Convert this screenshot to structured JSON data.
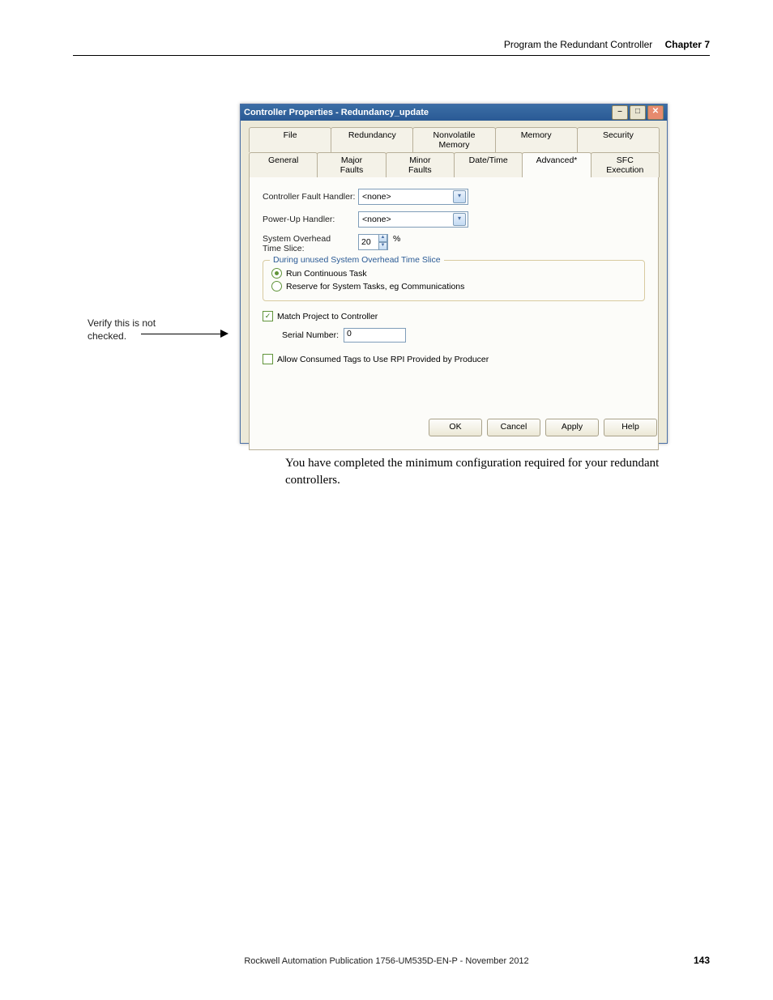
{
  "header": {
    "title": "Program the Redundant Controller",
    "chapter": "Chapter 7"
  },
  "callout": {
    "line1": "Verify this is not",
    "line2": "checked."
  },
  "dialog": {
    "title": "Controller Properties - Redundancy_update",
    "tabs_row1": [
      "File",
      "Redundancy",
      "Nonvolatile Memory",
      "Memory",
      "Security"
    ],
    "tabs_row2": [
      "General",
      "Major Faults",
      "Minor Faults",
      "Date/Time",
      "Advanced*",
      "SFC Execution"
    ],
    "active_tab": "Advanced*",
    "labels": {
      "fault_handler": "Controller Fault Handler:",
      "power_up": "Power-Up Handler:",
      "overhead": "System Overhead",
      "overhead2": "Time Slice:",
      "fieldset_title": "During unused System Overhead Time Slice",
      "radio1": "Run Continuous Task",
      "radio2": "Reserve for System Tasks, eg Communications",
      "match_project": "Match Project to Controller",
      "serial": "Serial Number:",
      "allow_consumed": "Allow Consumed Tags to Use RPI Provided by Producer"
    },
    "values": {
      "fault_handler": "<none>",
      "power_up": "<none>",
      "overhead": "20",
      "serial": "0"
    },
    "buttons": {
      "ok": "OK",
      "cancel": "Cancel",
      "apply": "Apply",
      "help": "Help"
    }
  },
  "body_text": "You have completed the minimum configuration required for your redundant controllers.",
  "footer": "Rockwell Automation Publication 1756-UM535D-EN-P - November 2012",
  "page_number": "143"
}
